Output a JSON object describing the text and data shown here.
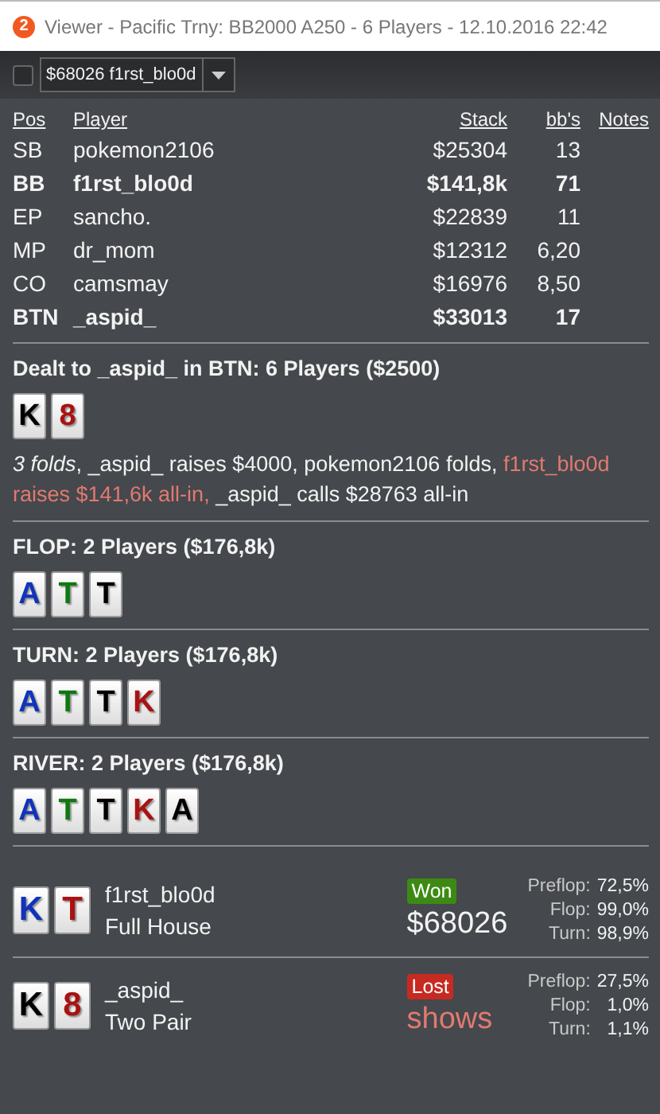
{
  "window": {
    "title": "Viewer - Pacific Trny: BB2000 A250 - 6 Players - 12.10.2016 22:42",
    "badge": "2"
  },
  "toolbar": {
    "checked": false,
    "hand_select": "$68026 f1rst_blo0d"
  },
  "players_table": {
    "columns": [
      "Pos",
      "Player",
      "Stack",
      "bb's",
      "Notes"
    ],
    "rows": [
      {
        "pos": "SB",
        "player": "pokemon2106",
        "stack": "$25304",
        "bbs": "13",
        "highlighted": false
      },
      {
        "pos": "BB",
        "player": "f1rst_blo0d",
        "stack": "$141,8k",
        "bbs": "71",
        "highlighted": true
      },
      {
        "pos": "EP",
        "player": "sancho.",
        "stack": "$22839",
        "bbs": "11",
        "highlighted": false
      },
      {
        "pos": "MP",
        "player": "dr_mom",
        "stack": "$12312",
        "bbs": "6,20",
        "highlighted": false
      },
      {
        "pos": "CO",
        "player": "camsmay",
        "stack": "$16976",
        "bbs": "8,50",
        "highlighted": false
      },
      {
        "pos": "BTN",
        "player": "_aspid_",
        "stack": "$33013",
        "bbs": "17",
        "highlighted": true
      }
    ]
  },
  "streets": [
    {
      "title": "Dealt to _aspid_ in BTN: 6 Players ($2500)",
      "cards": [
        {
          "rank": "K",
          "color": "#000000"
        },
        {
          "rank": "8",
          "color": "#aa1111"
        }
      ],
      "actions": [
        {
          "kind": "folds",
          "text": "3 folds"
        },
        {
          "kind": "normal",
          "text": ", _aspid_ raises $4000, pokemon2106 folds, "
        },
        {
          "kind": "highlight",
          "text": "f1rst_blo0d raises $141,6k all-in,"
        },
        {
          "kind": "normal",
          "text": " _aspid_ calls $28763 all-in"
        }
      ]
    },
    {
      "title": "FLOP: 2 Players ($176,8k)",
      "cards": [
        {
          "rank": "A",
          "color": "#1133bb"
        },
        {
          "rank": "T",
          "color": "#117711"
        },
        {
          "rank": "T",
          "color": "#000000"
        }
      ]
    },
    {
      "title": "TURN: 2 Players ($176,8k)",
      "cards": [
        {
          "rank": "A",
          "color": "#1133bb"
        },
        {
          "rank": "T",
          "color": "#117711"
        },
        {
          "rank": "T",
          "color": "#000000"
        },
        {
          "rank": "K",
          "color": "#aa1111"
        }
      ]
    },
    {
      "title": "RIVER: 2 Players ($176,8k)",
      "cards": [
        {
          "rank": "A",
          "color": "#1133bb"
        },
        {
          "rank": "T",
          "color": "#117711"
        },
        {
          "rank": "T",
          "color": "#000000"
        },
        {
          "rank": "K",
          "color": "#aa1111"
        },
        {
          "rank": "A",
          "color": "#000000"
        }
      ]
    }
  ],
  "results": [
    {
      "cards": [
        {
          "rank": "K",
          "color": "#1133bb"
        },
        {
          "rank": "T",
          "color": "#aa1111"
        }
      ],
      "player": "f1rst_blo0d",
      "hand": "Full House",
      "won": true,
      "badge": "Won",
      "amount": "$68026",
      "equity": [
        {
          "label": "Preflop:",
          "value": "72,5%"
        },
        {
          "label": "Flop:",
          "value": "99,0%"
        },
        {
          "label": "Turn:",
          "value": "98,9%"
        }
      ]
    },
    {
      "cards": [
        {
          "rank": "K",
          "color": "#000000"
        },
        {
          "rank": "8",
          "color": "#aa1111"
        }
      ],
      "player": "_aspid_",
      "hand": "Two Pair",
      "won": false,
      "badge": "Lost",
      "amount": "shows",
      "equity": [
        {
          "label": "Preflop:",
          "value": "27,5%"
        },
        {
          "label": "Flop:",
          "value": "1,0%"
        },
        {
          "label": "Turn:",
          "value": "1,1%"
        }
      ]
    }
  ]
}
